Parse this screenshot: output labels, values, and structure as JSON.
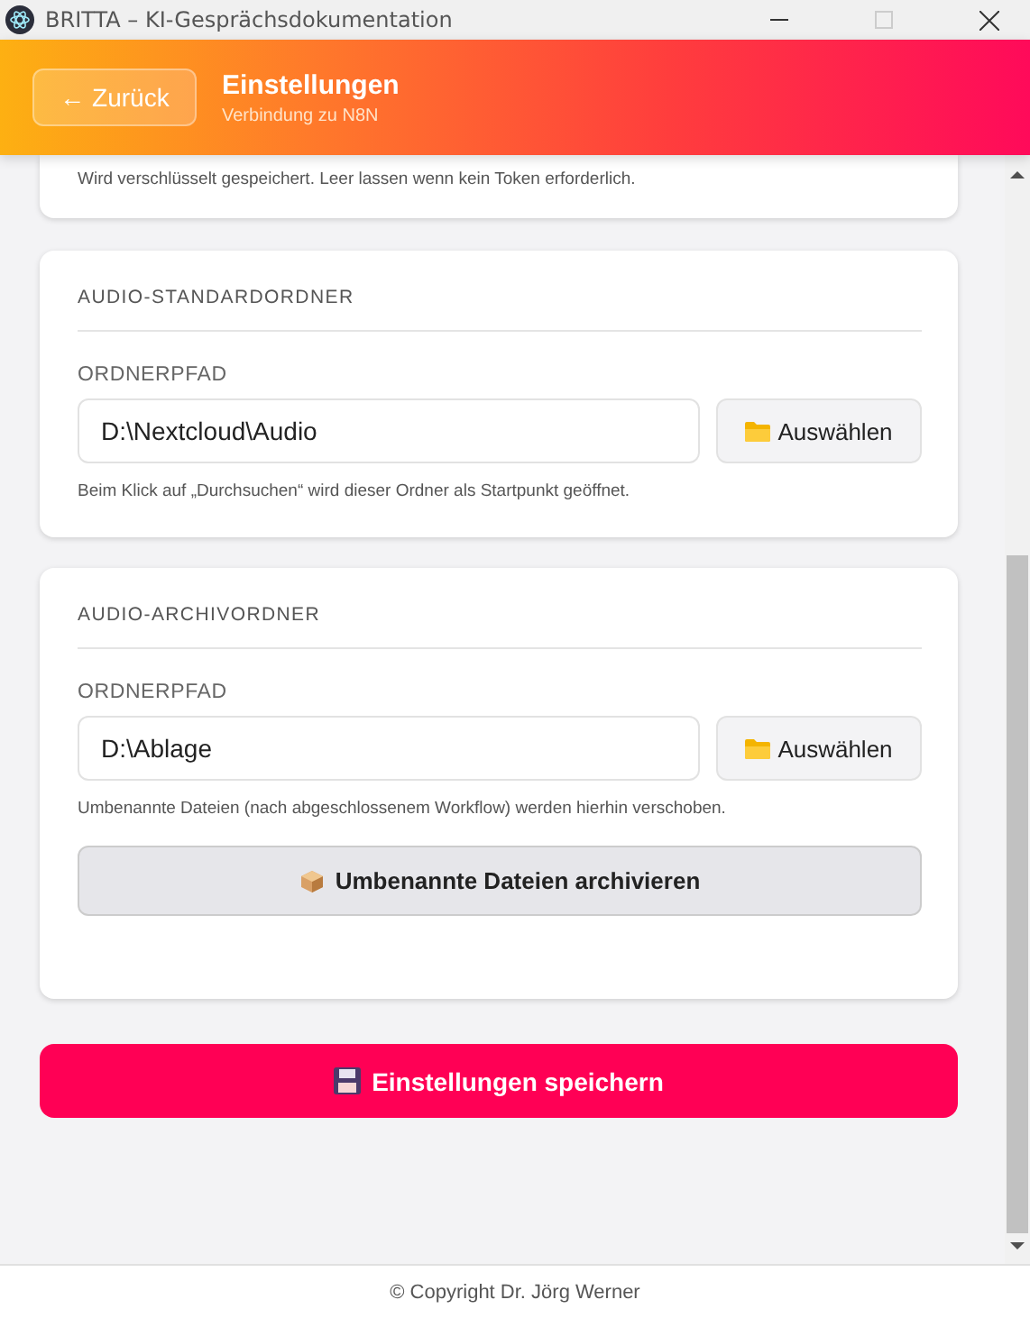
{
  "window": {
    "title": "BRITTA – KI-Gesprächsdokumentation"
  },
  "header": {
    "back_button": "← Zurück",
    "title": "Einstellungen",
    "subtitle": "Verbindung zu N8N"
  },
  "token_card": {
    "hint": "Wird verschlüsselt gespeichert. Leer lassen wenn kein Token erforderlich."
  },
  "sections": [
    {
      "heading": "AUDIO-STANDARDORDNER",
      "field_label": "ORDNERPFAD",
      "value": "D:\\Nextcloud\\Audio",
      "browse_button": "Auswählen",
      "hint": "Beim Klick auf „Durchsuchen“ wird dieser Ordner als Startpunkt geöffnet."
    },
    {
      "heading": "AUDIO-ARCHIVORDNER",
      "field_label": "ORDNERPFAD",
      "value": "D:\\Ablage",
      "browse_button": "Auswählen",
      "hint": "Umbenannte Dateien (nach abgeschlossenem Workflow) werden hierhin verschoben.",
      "action_button": "Umbenannte Dateien archivieren"
    }
  ],
  "save_button": "Einstellungen speichern",
  "footer": "© Copyright Dr. Jörg Werner"
}
